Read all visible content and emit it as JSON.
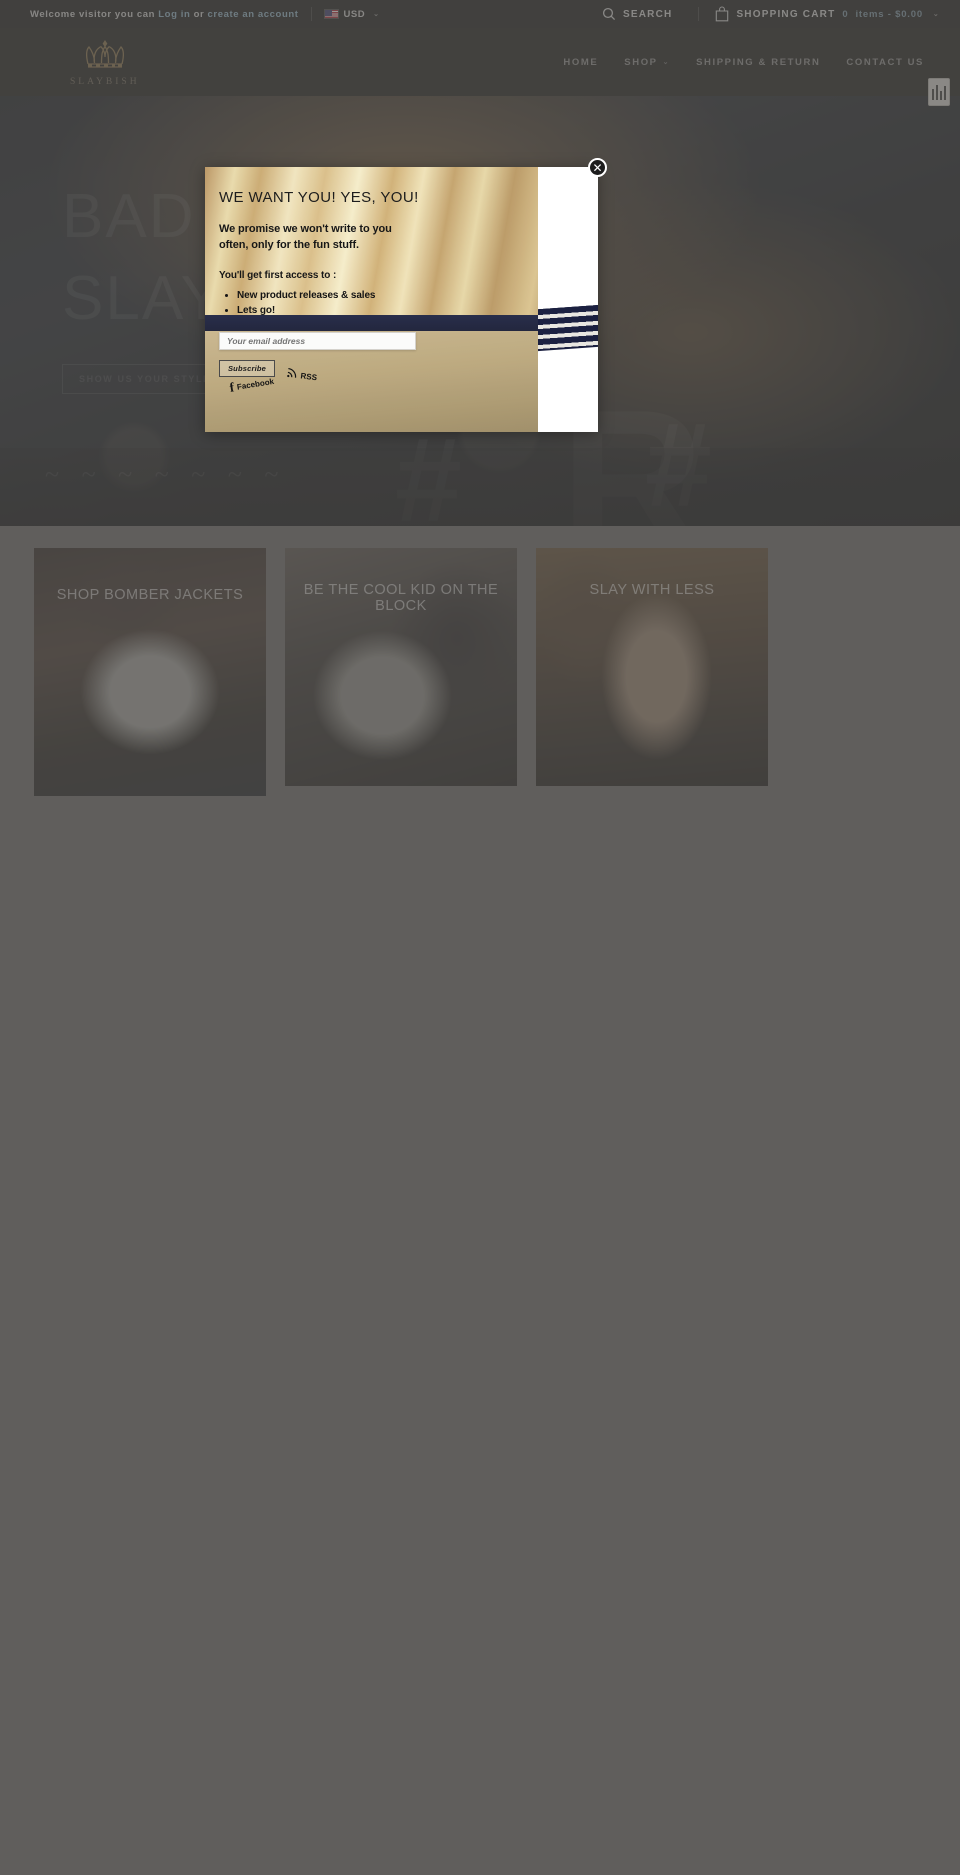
{
  "topbar": {
    "welcome_prefix": "Welcome visitor you can ",
    "login_label": "Log in",
    "or_label": " or ",
    "create_account_label": "create an account",
    "currency": "USD",
    "currency_caret": "⌄",
    "search_label": "SEARCH",
    "cart_label": "SHOPPING CART",
    "cart_count": "0",
    "cart_items_text": "items - $0.00",
    "cart_caret": "⌄"
  },
  "header": {
    "brand": "SLAYBISH",
    "nav": [
      {
        "label": "HOME",
        "has_caret": false
      },
      {
        "label": "SHOP",
        "has_caret": true
      },
      {
        "label": "SHIPPING & RETURN",
        "has_caret": false
      },
      {
        "label": "CONTACT US",
        "has_caret": false
      }
    ],
    "nav_caret": "⌄"
  },
  "hero": {
    "line1": "BAD GIRLS",
    "line2": "SLAY",
    "button_label": "SHOW US YOUR STYLE",
    "hash1": "#",
    "hash2": "#",
    "bigletter": "R",
    "squiggle": "~ ~ ~ ~ ~ ~ ~"
  },
  "promos": [
    {
      "label": "SHOP BOMBER JACKETS"
    },
    {
      "label": "BE THE COOL KID ON THE BLOCK"
    },
    {
      "label": "SLAY WITH LESS"
    }
  ],
  "modal": {
    "title": "WE WANT YOU! YES, YOU!",
    "subtitle": "We promise we won't write to you often, only for the fun stuff.",
    "access_label": "You'll get first access to :",
    "benefits": [
      "New product releases & sales",
      "Lets go!"
    ],
    "email_placeholder": "Your email address",
    "email_value": "",
    "subscribe_label": "Subscribe",
    "social": [
      {
        "icon": "facebook-icon",
        "glyph": "f",
        "label": "Facebook"
      },
      {
        "icon": "rss-icon",
        "glyph": "((",
        "label": "RSS"
      }
    ],
    "close_glyph": "✕"
  },
  "colors": {
    "accent_gold": "#6d6558",
    "link_blue": "#8fb4c9",
    "header_bg": "#1c1b19",
    "topbar_bg": "#191919"
  }
}
